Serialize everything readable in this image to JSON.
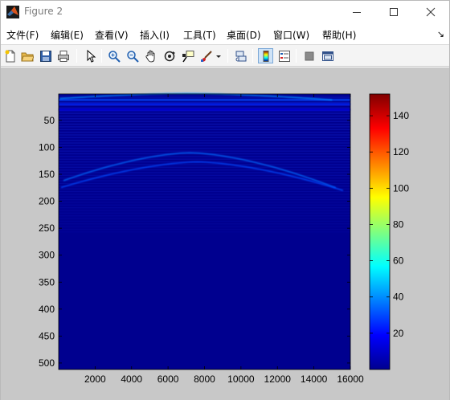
{
  "window": {
    "title": "Figure 2",
    "minimize_label": "minimize",
    "maximize_label": "maximize",
    "close_label": "close"
  },
  "menu": {
    "items": [
      {
        "label": "文件(F)"
      },
      {
        "label": "编辑(E)"
      },
      {
        "label": "查看(V)"
      },
      {
        "label": "插入(I)"
      },
      {
        "label": "工具(T)"
      },
      {
        "label": "桌面(D)"
      },
      {
        "label": "窗口(W)"
      },
      {
        "label": "帮助(H)"
      }
    ],
    "overflow_icon": "dock-arrow-icon"
  },
  "toolbar": {
    "buttons": [
      {
        "name": "new-figure-button",
        "icon": "new-file-icon"
      },
      {
        "name": "open-file-button",
        "icon": "folder-icon"
      },
      {
        "name": "save-figure-button",
        "icon": "floppy-icon"
      },
      {
        "name": "print-figure-button",
        "icon": "printer-icon"
      },
      {
        "name": "edit-plot-button",
        "icon": "pointer-icon"
      },
      {
        "name": "zoom-in-button",
        "icon": "zoom-in-icon"
      },
      {
        "name": "zoom-out-button",
        "icon": "zoom-out-icon"
      },
      {
        "name": "pan-button",
        "icon": "hand-icon"
      },
      {
        "name": "rotate-3d-button",
        "icon": "rotate-icon"
      },
      {
        "name": "data-cursor-button",
        "icon": "data-cursor-icon"
      },
      {
        "name": "brush-button",
        "icon": "brush-icon"
      },
      {
        "name": "link-plot-button",
        "icon": "link-icon"
      },
      {
        "name": "insert-colorbar-button",
        "icon": "colorbar-icon",
        "pressed": true
      },
      {
        "name": "insert-legend-button",
        "icon": "legend-icon"
      },
      {
        "name": "hide-plot-tools-button",
        "icon": "hide-tools-icon"
      },
      {
        "name": "show-plot-tools-button",
        "icon": "show-tools-icon"
      }
    ]
  },
  "chart_data": {
    "type": "heatmap",
    "title": "",
    "xlabel": "",
    "ylabel": "",
    "xlim": [
      1,
      16000
    ],
    "ylim": [
      512,
      1
    ],
    "y_reversed": true,
    "xticks": [
      2000,
      4000,
      6000,
      8000,
      10000,
      12000,
      14000,
      16000
    ],
    "yticks": [
      50,
      100,
      150,
      200,
      250,
      300,
      350,
      400,
      450,
      500
    ],
    "colorbar": {
      "clim": [
        0,
        152
      ],
      "ticks": [
        20,
        40,
        60,
        80,
        100,
        120,
        140
      ],
      "colormap": "jet"
    },
    "background_color": "#00008f",
    "figure_color": "#c8c8c8",
    "features": [
      {
        "kind": "band",
        "y": 12,
        "value": 30,
        "x_from": 0,
        "x_to": 16000
      },
      {
        "kind": "band",
        "y": 20,
        "value": 25,
        "x_from": 0,
        "x_to": 16000
      },
      {
        "kind": "band",
        "y": 30,
        "value": 15,
        "x_from": 0,
        "x_to": 16000
      },
      {
        "kind": "hyperbola",
        "apex_x": 7000,
        "apex_y": 0,
        "end_y": 12,
        "value": 40
      },
      {
        "kind": "hyperbola",
        "apex_x": 7200,
        "apex_y": 110,
        "end_y": 175,
        "value": 35
      },
      {
        "kind": "hyperbola",
        "apex_x": 7600,
        "apex_y": 127,
        "end_y": 180,
        "value": 30
      }
    ]
  }
}
